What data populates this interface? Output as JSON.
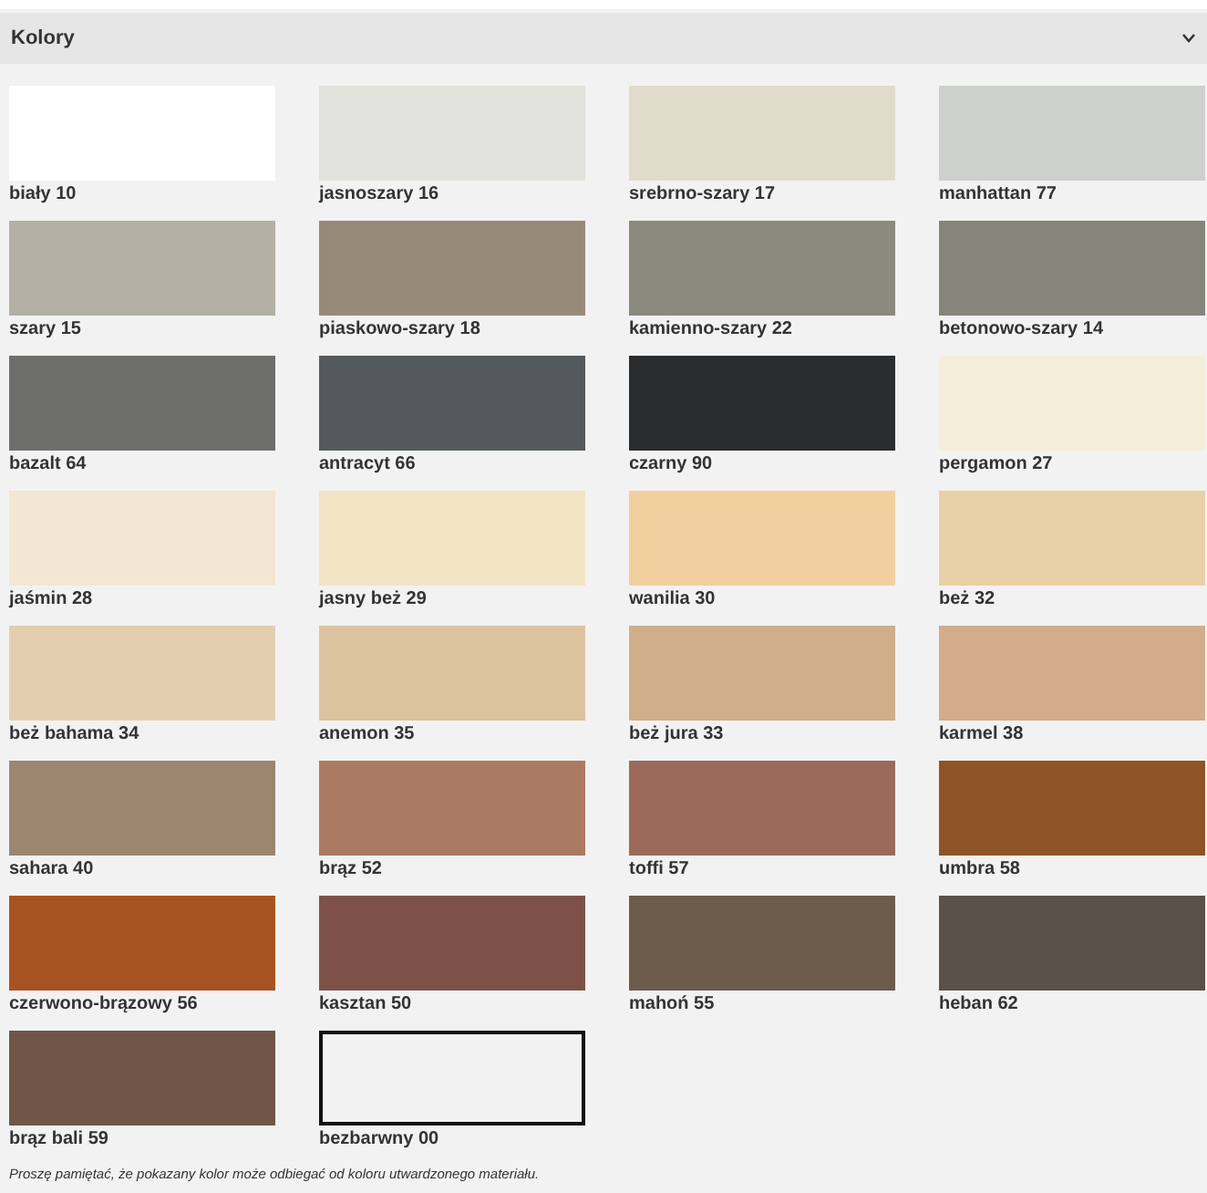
{
  "section": {
    "title": "Kolory",
    "expanded": true
  },
  "swatches": [
    {
      "kind": "solid",
      "name": "biały 10",
      "color": "#ffffff"
    },
    {
      "kind": "solid",
      "name": "jasnoszary 16",
      "color": "#e2e2dc"
    },
    {
      "kind": "solid",
      "name": "srebrno-szary 17",
      "color": "#e0dccb"
    },
    {
      "kind": "solid",
      "name": "manhattan 77",
      "color": "#cdd0cc"
    },
    {
      "kind": "solid",
      "name": "szary 15",
      "color": "#b3b0a6"
    },
    {
      "kind": "solid",
      "name": "piaskowo-szary 18",
      "color": "#978a79"
    },
    {
      "kind": "solid",
      "name": "kamienno-szary 22",
      "color": "#8b8a7f"
    },
    {
      "kind": "solid",
      "name": "betonowo-szary 14",
      "color": "#86857b"
    },
    {
      "kind": "solid",
      "name": "bazalt 64",
      "color": "#6e6e6c"
    },
    {
      "kind": "solid",
      "name": "antracyt 66",
      "color": "#545a5c"
    },
    {
      "kind": "solid",
      "name": "czarny 90",
      "color": "#2a2c2e"
    },
    {
      "kind": "solid",
      "name": "pergamon 27",
      "color": "#f5eedb"
    },
    {
      "kind": "solid",
      "name": "jaśmin 28",
      "color": "#f3e7d4"
    },
    {
      "kind": "solid",
      "name": "jasny beż 29",
      "color": "#f3e4c4"
    },
    {
      "kind": "solid",
      "name": "wanilia 30",
      "color": "#f2cf9f"
    },
    {
      "kind": "solid",
      "name": "beż 32",
      "color": "#e8d1a8"
    },
    {
      "kind": "solid",
      "name": "beż bahama 34",
      "color": "#e3cfb0"
    },
    {
      "kind": "solid",
      "name": "anemon 35",
      "color": "#dcc3a0"
    },
    {
      "kind": "solid",
      "name": "beż jura 33",
      "color": "#d0ad8b"
    },
    {
      "kind": "solid",
      "name": "karmel 38",
      "color": "#d2ac8b"
    },
    {
      "kind": "solid",
      "name": "sahara 40",
      "color": "#9a8671"
    },
    {
      "kind": "solid",
      "name": "brąz 52",
      "color": "#ab7a63"
    },
    {
      "kind": "solid",
      "name": "toffi 57",
      "color": "#9b6a5a"
    },
    {
      "kind": "solid",
      "name": "umbra 58",
      "color": "#8e5427"
    },
    {
      "kind": "solid",
      "name": "czerwono-brązowy 56",
      "color": "#a75321"
    },
    {
      "kind": "solid",
      "name": "kasztan 50",
      "color": "#7e5148"
    },
    {
      "kind": "solid",
      "name": "mahoń 55",
      "color": "#6d5b4c"
    },
    {
      "kind": "solid",
      "name": "heban 62",
      "color": "#5a514a"
    },
    {
      "kind": "solid",
      "name": "brąz bali 59",
      "color": "#6f5646"
    },
    {
      "kind": "clear",
      "name": "bezbarwny 00"
    }
  ],
  "note": "Proszę pamiętać, że pokazany kolor może odbiegać od koloru utwardzonego materiału."
}
